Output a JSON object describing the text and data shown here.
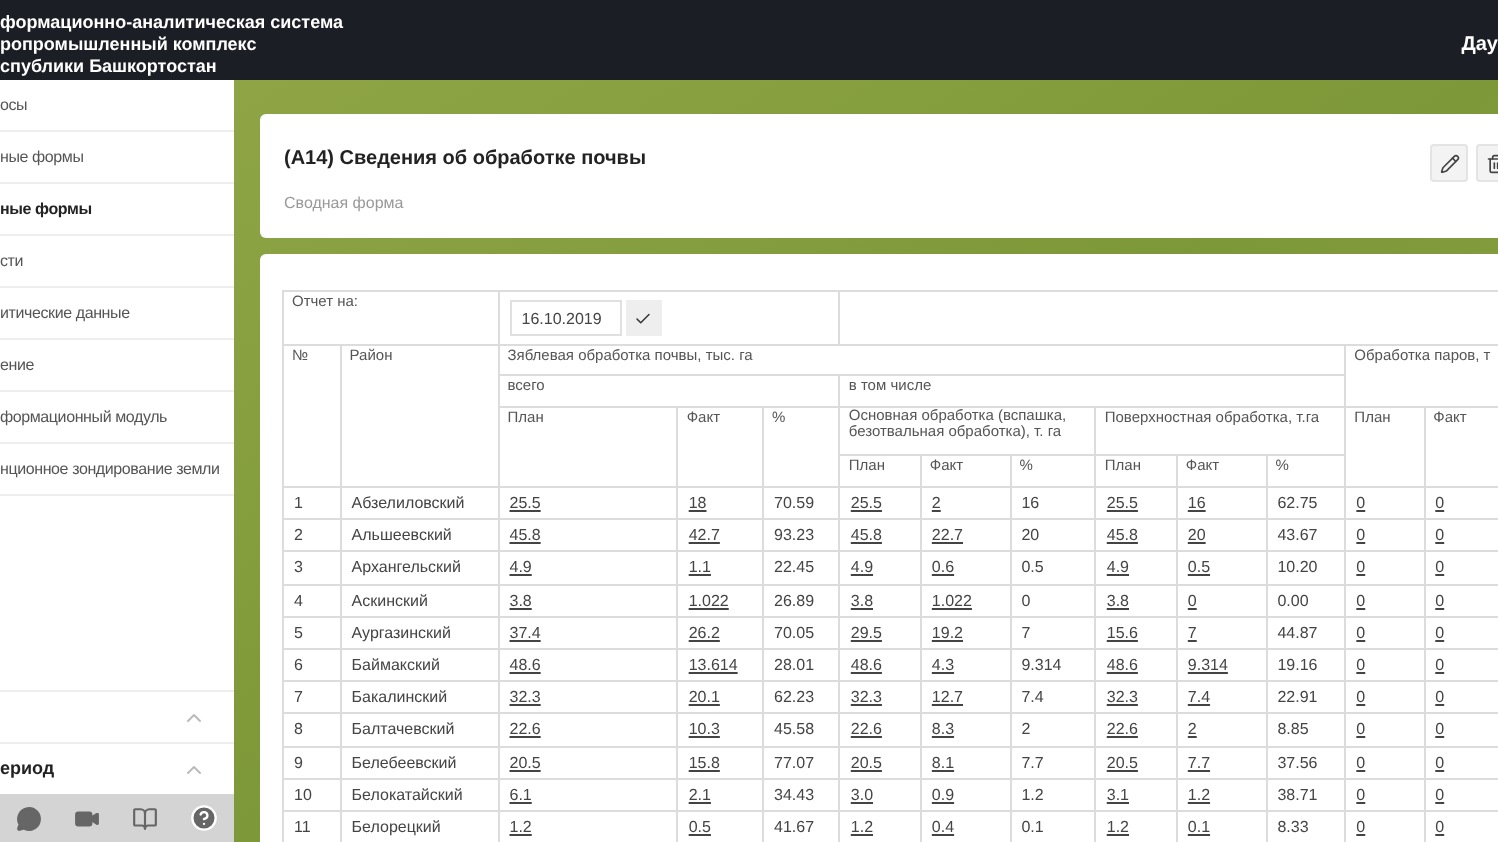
{
  "header": {
    "title_lines": [
      "формационно-аналитическая система",
      "ропромышленный комплекс",
      "спублики Башкортостан"
    ],
    "user": "Дау"
  },
  "sidebar": {
    "items": [
      {
        "label": "осы",
        "selected": false
      },
      {
        "label": "ные формы",
        "selected": false
      },
      {
        "label": "ные формы",
        "selected": true
      },
      {
        "label": "сти",
        "selected": false
      },
      {
        "label": "итические данные",
        "selected": false
      },
      {
        "label": "ение",
        "selected": false
      },
      {
        "label": "формационный модуль",
        "selected": false
      },
      {
        "label": "нционное зондирование земли",
        "selected": false
      }
    ],
    "sections": [
      {
        "expanded": true
      },
      {
        "label": "ериод",
        "expanded": true
      }
    ]
  },
  "page": {
    "title": "(А14) Сведения об обработке почвы",
    "subtitle": "Сводная форма"
  },
  "table": {
    "report_label": "Отчет на:",
    "report_date": "16.10.2019",
    "col_num": "№",
    "col_district": "Район",
    "group_autumn": "Зяблевая обработка почвы, тыс. га",
    "group_fallow": "Обработка паров, т",
    "sub_total": "всего",
    "sub_including": "в том числе",
    "sub_main": "Основная обработка (вспашка, безотвальная обработка), т. га",
    "sub_surface": "Поверхностная обработка, т.га",
    "total_headers": [
      "План",
      "Факт",
      "%"
    ],
    "main_headers": [
      "План",
      "Факт",
      "%"
    ],
    "surface_headers": [
      "План",
      "Факт",
      "%"
    ],
    "fallow_headers": [
      "План",
      "Факт"
    ],
    "rows": [
      {
        "num": "1",
        "district": "Абзелиловский",
        "cells": [
          "25.5",
          "18",
          "70.59",
          "25.5",
          "2",
          "16",
          "25.5",
          "16",
          "62.75",
          "0",
          "0"
        ]
      },
      {
        "num": "2",
        "district": "Альшеевский",
        "cells": [
          "45.8",
          "42.7",
          "93.23",
          "45.8",
          "22.7",
          "20",
          "45.8",
          "20",
          "43.67",
          "0",
          "0"
        ]
      },
      {
        "num": "3",
        "district": "Архангельский",
        "cells": [
          "4.9",
          "1.1",
          "22.45",
          "4.9",
          "0.6",
          "0.5",
          "4.9",
          "0.5",
          "10.20",
          "0",
          "0"
        ]
      },
      {
        "num": "4",
        "district": "Аскинский",
        "cells": [
          "3.8",
          "1.022",
          "26.89",
          "3.8",
          "1.022",
          "0",
          "3.8",
          "0",
          "0.00",
          "0",
          "0"
        ]
      },
      {
        "num": "5",
        "district": "Аургазинский",
        "cells": [
          "37.4",
          "26.2",
          "70.05",
          "29.5",
          "19.2",
          "7",
          "15.6",
          "7",
          "44.87",
          "0",
          "0"
        ]
      },
      {
        "num": "6",
        "district": "Баймакский",
        "cells": [
          "48.6",
          "13.614",
          "28.01",
          "48.6",
          "4.3",
          "9.314",
          "48.6",
          "9.314",
          "19.16",
          "0",
          "0"
        ]
      },
      {
        "num": "7",
        "district": "Бакалинский",
        "cells": [
          "32.3",
          "20.1",
          "62.23",
          "32.3",
          "12.7",
          "7.4",
          "32.3",
          "7.4",
          "22.91",
          "0",
          "0"
        ]
      },
      {
        "num": "8",
        "district": "Балтачевский",
        "cells": [
          "22.6",
          "10.3",
          "45.58",
          "22.6",
          "8.3",
          "2",
          "22.6",
          "2",
          "8.85",
          "0",
          "0"
        ]
      },
      {
        "num": "9",
        "district": "Белебеевский",
        "cells": [
          "20.5",
          "15.8",
          "77.07",
          "20.5",
          "8.1",
          "7.7",
          "20.5",
          "7.7",
          "37.56",
          "0",
          "0"
        ]
      },
      {
        "num": "10",
        "district": "Белокатайский",
        "cells": [
          "6.1",
          "2.1",
          "34.43",
          "3.0",
          "0.9",
          "1.2",
          "3.1",
          "1.2",
          "38.71",
          "0",
          "0"
        ]
      },
      {
        "num": "11",
        "district": "Белорецкий",
        "cells": [
          "1.2",
          "0.5",
          "41.67",
          "1.2",
          "0.4",
          "0.1",
          "1.2",
          "0.1",
          "8.33",
          "0",
          "0"
        ]
      }
    ]
  }
}
